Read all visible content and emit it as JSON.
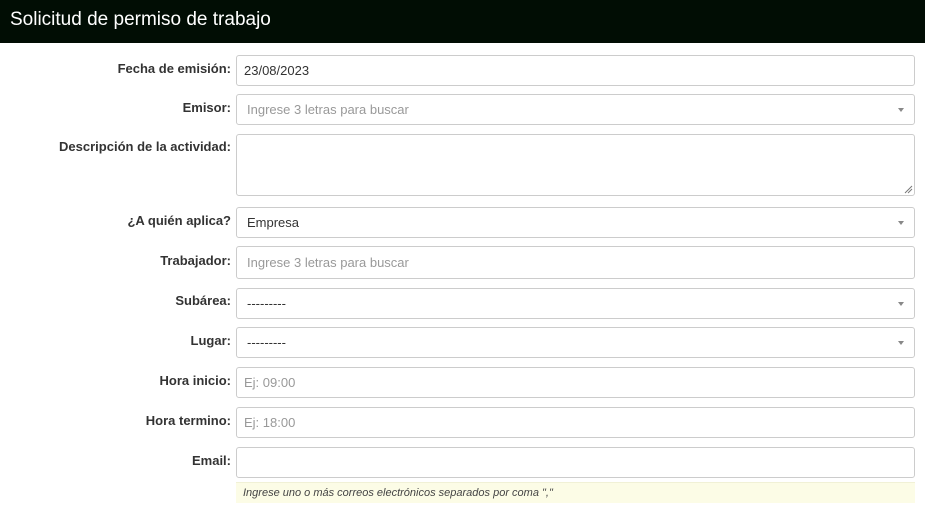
{
  "header": {
    "title": "Solicitud de permiso de trabajo"
  },
  "form": {
    "fecha_emision": {
      "label": "Fecha de emisión:",
      "value": "23/08/2023"
    },
    "emisor": {
      "label": "Emisor:",
      "placeholder": "Ingrese 3 letras para buscar"
    },
    "descripcion": {
      "label": "Descripción de la actividad:",
      "value": ""
    },
    "a_quien_aplica": {
      "label": "¿A quién aplica?",
      "value": "Empresa"
    },
    "trabajador": {
      "label": "Trabajador:",
      "placeholder": "Ingrese 3 letras para buscar"
    },
    "subarea": {
      "label": "Subárea:",
      "value": "---------"
    },
    "lugar": {
      "label": "Lugar:",
      "value": "---------"
    },
    "hora_inicio": {
      "label": "Hora inicio:",
      "placeholder": "Ej: 09:00"
    },
    "hora_termino": {
      "label": "Hora termino:",
      "placeholder": "Ej: 18:00"
    },
    "email": {
      "label": "Email:",
      "value": "",
      "help": "Ingrese uno o más correos electrónicos separados por coma \",\""
    }
  },
  "colors": {
    "header_bg": "#010d04",
    "border": "#cccccc",
    "help_bg": "#fcfce6"
  }
}
